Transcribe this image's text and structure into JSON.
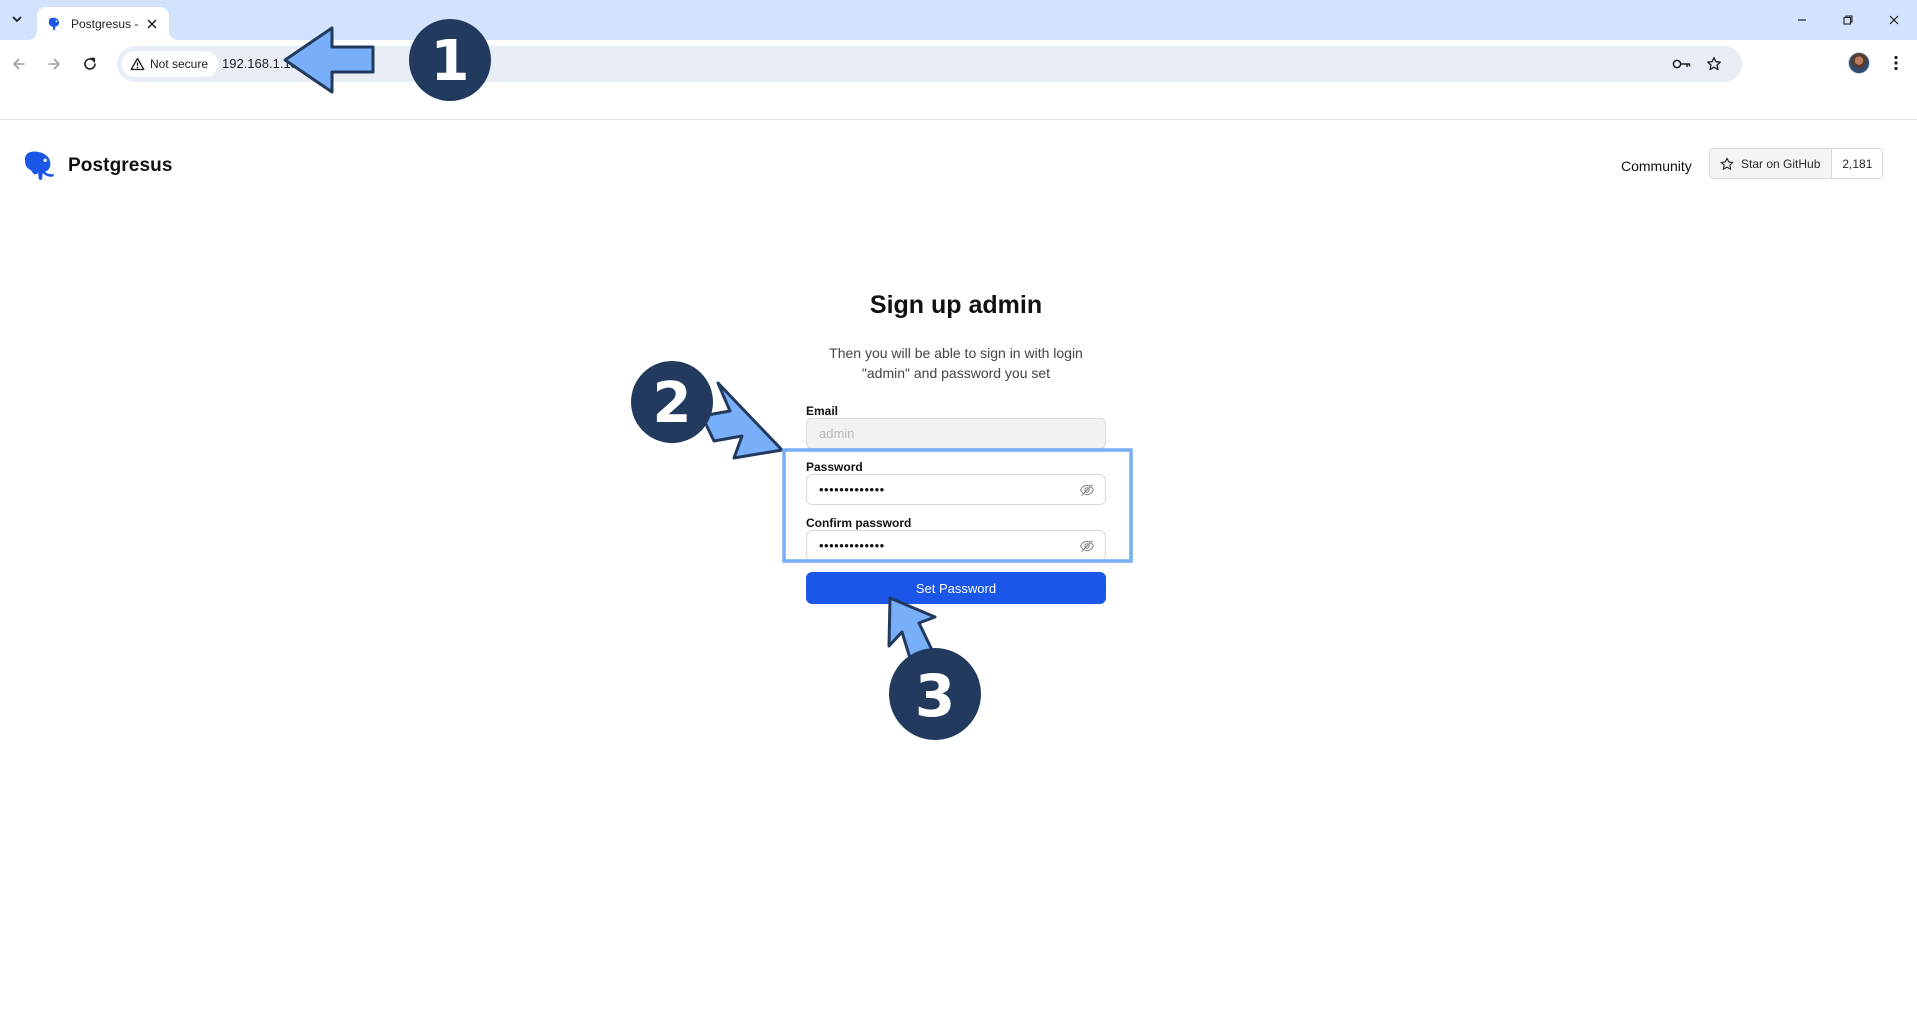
{
  "browser": {
    "tab_title": "Postgresus -",
    "security_label": "Not secure",
    "url": "192.168.1.18:4005"
  },
  "header": {
    "brand": "Postgresus",
    "community": "Community",
    "github_button": "Star on GitHub",
    "github_count": "2,181"
  },
  "form": {
    "title": "Sign up admin",
    "subtitle_line1": "Then you will be able to sign in with login",
    "subtitle_line2": "\"admin\" and password you set",
    "email_label": "Email",
    "email_placeholder": "admin",
    "password_label": "Password",
    "password_value": "•••••••••••••",
    "confirm_label": "Confirm password",
    "confirm_value": "•••••••••••••",
    "submit_label": "Set Password"
  },
  "annotations": {
    "step1": "1",
    "step2": "2",
    "step3": "3",
    "arrow_color": "#79aef8",
    "badge_color": "#233a5f"
  }
}
